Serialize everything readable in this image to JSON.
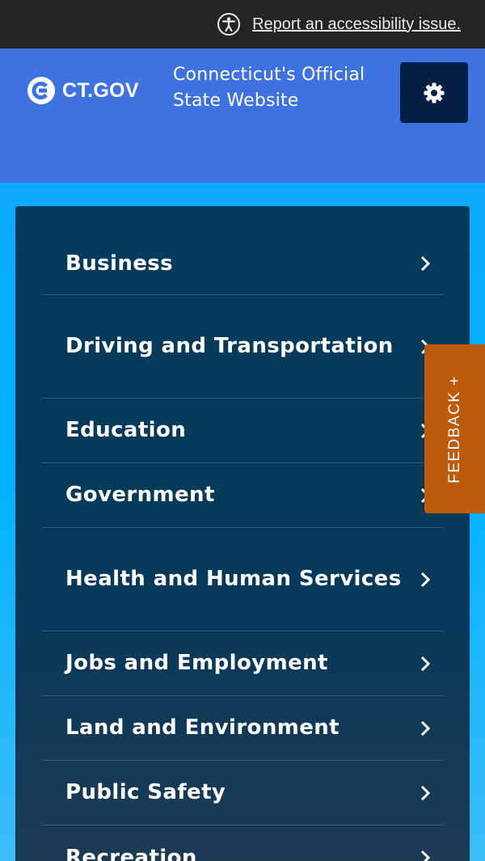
{
  "accessibility": {
    "link_label": "Report an accessibility issue.",
    "icon": "accessibility-icon"
  },
  "header": {
    "logo_text": "CT.GOV",
    "logo_icon": "ct-logo-mark",
    "tagline": "Connecticut's Official State Website",
    "settings_icon": "gear-icon",
    "colors": {
      "header_bg": "#3d72e0",
      "settings_bg": "#041e46"
    }
  },
  "nav": {
    "items": [
      {
        "label": "Business"
      },
      {
        "label": "Driving and Transportation"
      },
      {
        "label": "Education"
      },
      {
        "label": "Government"
      },
      {
        "label": "Health and Human Services"
      },
      {
        "label": "Jobs and Employment"
      },
      {
        "label": "Land and Environment"
      },
      {
        "label": "Public Safety"
      },
      {
        "label": "Recreation"
      }
    ],
    "chevron_icon": "chevron-right-icon",
    "colors": {
      "panel_bg": "#053b5c",
      "divider": "#2f5d78"
    }
  },
  "feedback": {
    "label": "FEEDBACK +",
    "color": "#bd5a0c"
  }
}
